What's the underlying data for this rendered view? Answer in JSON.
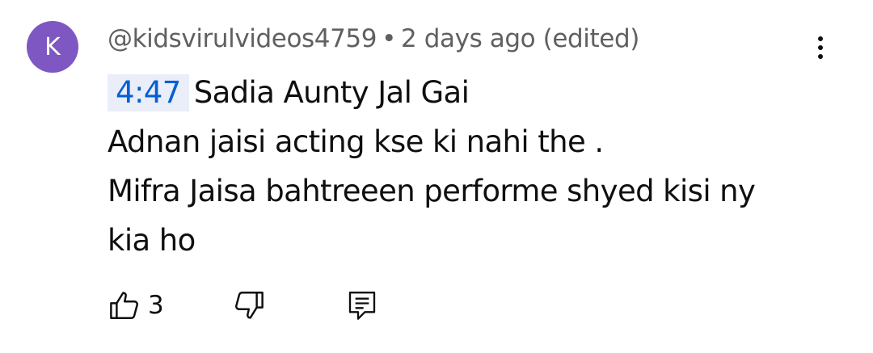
{
  "comment": {
    "author": {
      "avatar_letter": "K",
      "avatar_color": "#7e57c2",
      "handle": "@kidsvirulvideos4759"
    },
    "separator": "•",
    "time_ago": "2 days ago (edited)",
    "timestamp": "4:47",
    "lines": [
      "Sadia Aunty Jal Gai",
      "Adnan jaisi acting kse ki nahi the .",
      "Mifra Jaisa bahtreeen performe shyed kisi ny",
      "kia ho"
    ],
    "timestamp_color": "#065fd4",
    "timestamp_bg": "#e9eef8",
    "actions": {
      "like_icon": "thumbs-up-icon",
      "like_count": "3",
      "dislike_icon": "thumbs-down-icon",
      "reply_icon": "comment-reply-icon"
    },
    "more_icon": "more-vertical-icon"
  }
}
